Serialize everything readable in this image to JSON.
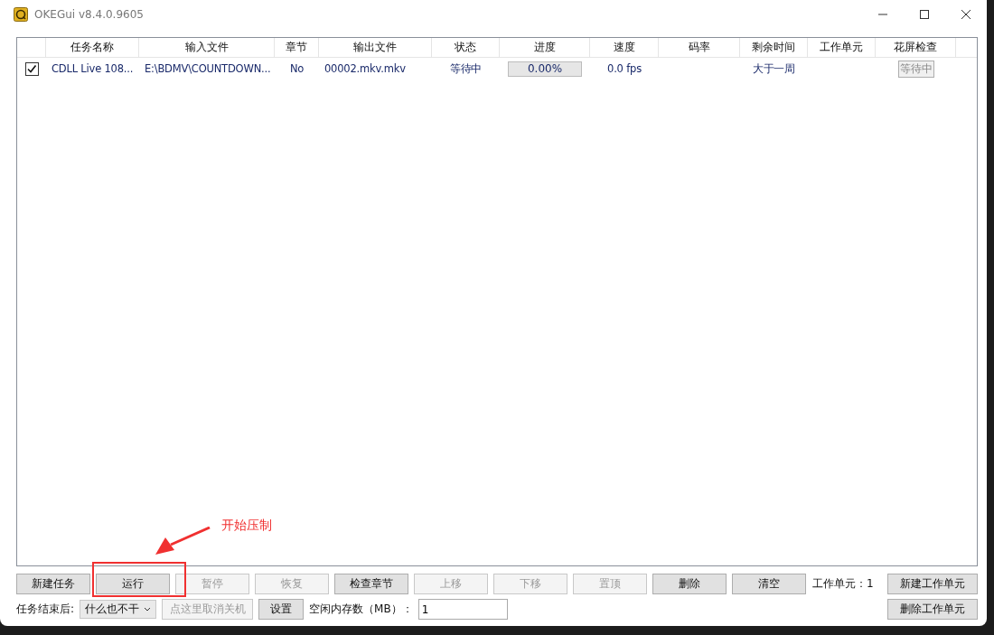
{
  "window": {
    "title": "OKEGui v8.4.0.9605"
  },
  "table": {
    "columns": [
      "任务名称",
      "输入文件",
      "章节",
      "输出文件",
      "状态",
      "进度",
      "速度",
      "码率",
      "剩余时间",
      "工作单元",
      "花屏检查"
    ],
    "rows": [
      {
        "checked": true,
        "name": "CDLL Live 108...",
        "input": "E:\\BDMV\\COUNTDOWN...",
        "chapters": "No",
        "output": "00002.mkv.mkv",
        "status": "等待中",
        "progress": "0.00%",
        "level": 0,
        "speed": "0.0 fps",
        "bitrate": "",
        "remaining": "大于一周",
        "work_unit": "",
        "check_button": "等待中"
      }
    ]
  },
  "buttons": [
    {
      "label": "新建任务",
      "disabled": false
    },
    {
      "label": "运行",
      "disabled": false
    },
    {
      "label": "暂停",
      "disabled": true
    },
    {
      "label": "恢复",
      "disabled": true
    },
    {
      "label": "检查章节",
      "disabled": false
    },
    {
      "label": "上移",
      "disabled": true
    },
    {
      "label": "下移",
      "disabled": true
    },
    {
      "label": "置顶",
      "disabled": true
    },
    {
      "label": "删除",
      "disabled": false
    },
    {
      "label": "清空",
      "disabled": false
    }
  ],
  "work_unit_label": "工作单元：1",
  "new_work_unit_button": "新建工作单元",
  "after_finish": {
    "label": "任务结束后:",
    "value": "什么也不干"
  },
  "cancel_shutdown_button": {
    "label": "点这里取消关机",
    "disabled": true
  },
  "settings_button": "设置",
  "free_memory": {
    "label": "空闲内存数（MB）：",
    "value": "1"
  },
  "delete_work_unit_button": "删除工作单元",
  "annotation": {
    "text": "开始压制"
  }
}
